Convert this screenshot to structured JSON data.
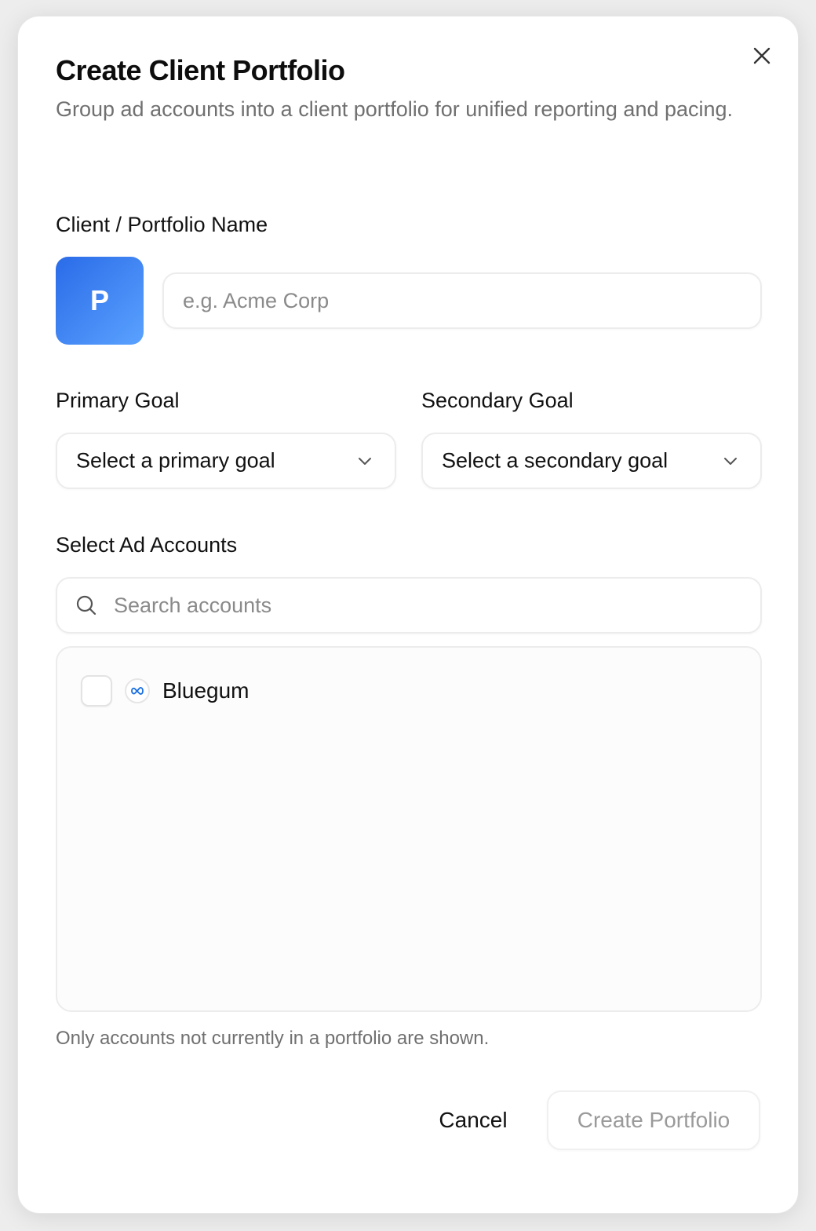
{
  "dialog": {
    "title": "Create Client Portfolio",
    "subtitle": "Group ad accounts into a client portfolio for unified reporting and pacing.",
    "close_icon": "close-icon"
  },
  "name_section": {
    "label": "Client / Portfolio Name",
    "avatar_letter": "P",
    "avatar_colors": [
      "#2a6be8",
      "#5aa2ff"
    ],
    "input_value": "",
    "input_placeholder": "e.g. Acme Corp"
  },
  "goals": {
    "primary": {
      "label": "Primary Goal",
      "selected": "Select a primary goal",
      "icon": "chevron-down-icon"
    },
    "secondary": {
      "label": "Secondary Goal",
      "selected": "Select a secondary goal",
      "icon": "chevron-down-icon"
    }
  },
  "accounts": {
    "label": "Select Ad Accounts",
    "search_placeholder": "Search accounts",
    "search_icon": "search-icon",
    "items": [
      {
        "name": "Bluegum",
        "checked": false,
        "platform_icon": "meta-icon"
      }
    ],
    "hint": "Only accounts not currently in a portfolio are shown."
  },
  "footer": {
    "cancel_label": "Cancel",
    "create_label": "Create Portfolio"
  }
}
